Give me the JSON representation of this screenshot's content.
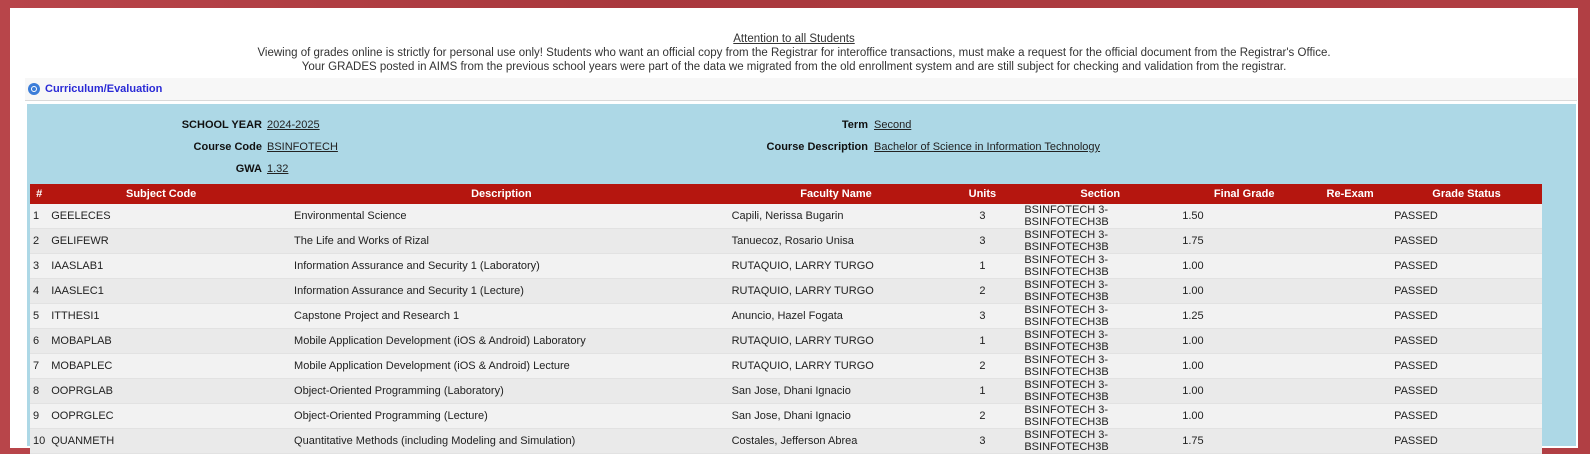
{
  "notice": {
    "title": "Attention to all Students",
    "line1": "Viewing of grades online is strictly for personal use only! Students who want an official copy from the Registrar for interoffice transactions, must make a request for the official document from the Registrar's Office.",
    "line2": "Your GRADES posted in AIMS from the previous school years were part of the data we migrated from the old enrollment system and are still subject for checking and validation from the registrar."
  },
  "section": {
    "label": "Curriculum/Evaluation",
    "icon": "search-icon"
  },
  "info": {
    "school_year_label": "SCHOOL YEAR",
    "school_year": "2024-2025",
    "term_label": "Term",
    "term": "Second",
    "course_code_label": "Course Code",
    "course_code": "BSINFOTECH",
    "course_desc_label": "Course Description",
    "course_desc": "Bachelor of Science in Information Technology",
    "gwa_label": "GWA",
    "gwa": "1.32"
  },
  "table": {
    "headers": [
      "#",
      "Subject Code",
      "Description",
      "Faculty Name",
      "Units",
      "Section",
      "Final Grade",
      "Re-Exam",
      "Grade Status"
    ],
    "rows": [
      {
        "num": "1",
        "code": "GEELECES",
        "desc": "Environmental Science",
        "faculty": "Capili, Nerissa Bugarin",
        "units": "3",
        "section": "BSINFOTECH 3-BSINFOTECH3B",
        "grade": "1.50",
        "reexam": "",
        "status": "PASSED"
      },
      {
        "num": "2",
        "code": "GELIFEWR",
        "desc": "The Life and Works of Rizal",
        "faculty": "Tanuecoz, Rosario Unisa",
        "units": "3",
        "section": "BSINFOTECH 3-BSINFOTECH3B",
        "grade": "1.75",
        "reexam": "",
        "status": "PASSED"
      },
      {
        "num": "3",
        "code": "IAASLAB1",
        "desc": "Information Assurance and Security 1 (Laboratory)",
        "faculty": "RUTAQUIO, LARRY TURGO",
        "units": "1",
        "section": "BSINFOTECH 3-BSINFOTECH3B",
        "grade": "1.00",
        "reexam": "",
        "status": "PASSED"
      },
      {
        "num": "4",
        "code": "IAASLEC1",
        "desc": "Information Assurance and Security 1 (Lecture)",
        "faculty": "RUTAQUIO, LARRY TURGO",
        "units": "2",
        "section": "BSINFOTECH 3-BSINFOTECH3B",
        "grade": "1.00",
        "reexam": "",
        "status": "PASSED"
      },
      {
        "num": "5",
        "code": "ITTHESI1",
        "desc": "Capstone Project and Research 1",
        "faculty": "Anuncio, Hazel Fogata",
        "units": "3",
        "section": "BSINFOTECH 3-BSINFOTECH3B",
        "grade": "1.25",
        "reexam": "",
        "status": "PASSED"
      },
      {
        "num": "6",
        "code": "MOBAPLAB",
        "desc": "Mobile Application Development (iOS & Android) Laboratory",
        "faculty": "RUTAQUIO, LARRY TURGO",
        "units": "1",
        "section": "BSINFOTECH 3-BSINFOTECH3B",
        "grade": "1.00",
        "reexam": "",
        "status": "PASSED"
      },
      {
        "num": "7",
        "code": "MOBAPLEC",
        "desc": "Mobile Application Development (iOS & Android) Lecture",
        "faculty": "RUTAQUIO, LARRY TURGO",
        "units": "2",
        "section": "BSINFOTECH 3-BSINFOTECH3B",
        "grade": "1.00",
        "reexam": "",
        "status": "PASSED"
      },
      {
        "num": "8",
        "code": "OOPRGLAB",
        "desc": "Object-Oriented Programming (Laboratory)",
        "faculty": "San Jose, Dhani Ignacio",
        "units": "1",
        "section": "BSINFOTECH 3-BSINFOTECH3B",
        "grade": "1.00",
        "reexam": "",
        "status": "PASSED"
      },
      {
        "num": "9",
        "code": "OOPRGLEC",
        "desc": "Object-Oriented Programming (Lecture)",
        "faculty": "San Jose, Dhani Ignacio",
        "units": "2",
        "section": "BSINFOTECH 3-BSINFOTECH3B",
        "grade": "1.00",
        "reexam": "",
        "status": "PASSED"
      },
      {
        "num": "10",
        "code": "QUANMETH",
        "desc": "Quantitative Methods (including Modeling and Simulation)",
        "faculty": "Costales, Jefferson Abrea",
        "units": "3",
        "section": "BSINFOTECH 3-BSINFOTECH3B",
        "grade": "1.75",
        "reexam": "",
        "status": "PASSED"
      }
    ]
  }
}
